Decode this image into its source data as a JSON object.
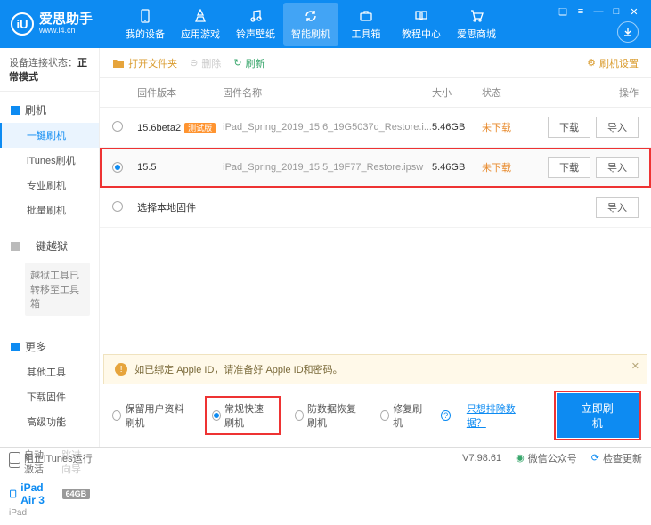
{
  "brand": {
    "name": "爱思助手",
    "url": "www.i4.cn",
    "logo_letter": "iU"
  },
  "nav": [
    {
      "label": "我的设备"
    },
    {
      "label": "应用游戏"
    },
    {
      "label": "铃声壁纸"
    },
    {
      "label": "智能刷机"
    },
    {
      "label": "工具箱"
    },
    {
      "label": "教程中心"
    },
    {
      "label": "爱思商城"
    }
  ],
  "sidebar": {
    "conn_label": "设备连接状态：",
    "conn_value": "正常模式",
    "groups": [
      {
        "head": "刷机",
        "items": [
          "一键刷机",
          "iTunes刷机",
          "专业刷机",
          "批量刷机"
        ],
        "active": 0
      },
      {
        "head": "一键越狱",
        "note": "越狱工具已转移至工具箱",
        "gray": true
      },
      {
        "head": "更多",
        "items": [
          "其他工具",
          "下载固件",
          "高级功能"
        ]
      }
    ],
    "auto_activate": "自动激活",
    "skip_guide": "跳过向导",
    "device": {
      "name": "iPad Air 3",
      "storage": "64GB",
      "type": "iPad"
    }
  },
  "toolbar": {
    "open_folder": "打开文件夹",
    "delete": "删除",
    "refresh": "刷新",
    "settings": "刷机设置"
  },
  "table": {
    "headers": {
      "version": "固件版本",
      "name": "固件名称",
      "size": "大小",
      "status": "状态",
      "ops": "操作"
    },
    "rows": [
      {
        "version": "15.6beta2",
        "beta": "测试版",
        "name": "iPad_Spring_2019_15.6_19G5037d_Restore.i...",
        "size": "5.46GB",
        "status": "未下载",
        "selected": false
      },
      {
        "version": "15.5",
        "name": "iPad_Spring_2019_15.5_19F77_Restore.ipsw",
        "size": "5.46GB",
        "status": "未下载",
        "selected": true,
        "highlight": true
      }
    ],
    "local_row": "选择本地固件",
    "btn_download": "下载",
    "btn_import": "导入"
  },
  "warning": "如已绑定 Apple ID，请准备好 Apple ID和密码。",
  "options": {
    "keep_data": "保留用户资料刷机",
    "normal": "常规快速刷机",
    "recovery": "防数据恢复刷机",
    "repair": "修复刷机",
    "exclude_link": "只想排除数据？",
    "flash_now": "立即刷机"
  },
  "statusbar": {
    "block_itunes": "阻止iTunes运行",
    "version": "V7.98.61",
    "wechat": "微信公众号",
    "check_update": "检查更新"
  }
}
